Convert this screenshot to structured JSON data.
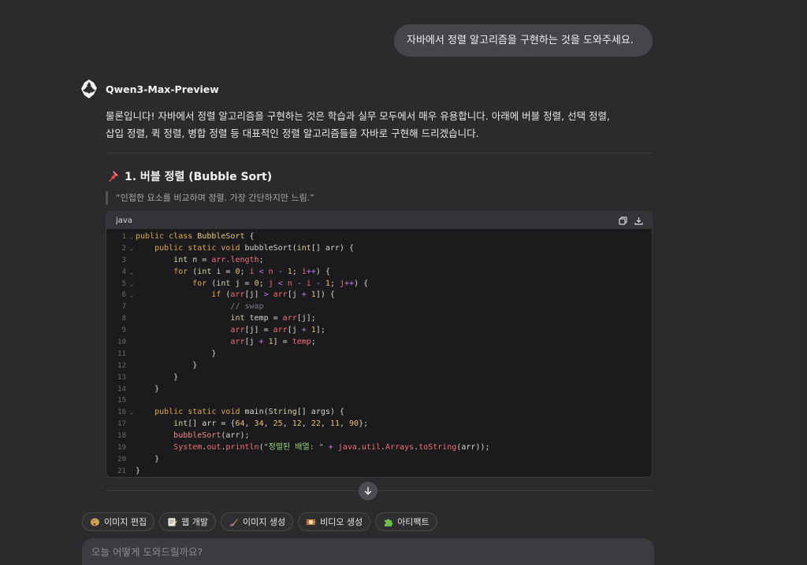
{
  "user_message": "자바에서 정렬 알고리즘을 구현하는 것을 도와주세요.",
  "assistant": {
    "model_name": "Qwen3-Max-Preview",
    "intro_line1": "물론입니다! 자바에서 정렬 알고리즘을 구현하는 것은 학습과 실무 모두에서 매우 유용합니다. 아래에 버블 정렬, 선택 정렬,",
    "intro_line2": "삽입 정렬, 퀵 정렬, 병합 정렬 등 대표적인 정렬 알고리즘들을 자바로 구현해 드리겠습니다.",
    "section_title": "1. 버블 정렬 (Bubble Sort)",
    "quote": "“인접한 요소를 비교하며 정렬. 가장 간단하지만 느림.”"
  },
  "code": {
    "language": "java",
    "copy_icon": "copy-icon",
    "download_icon": "download-icon",
    "lines": [
      {
        "n": "1",
        "fold": true,
        "tokens": [
          [
            "kw",
            "public "
          ],
          [
            "kw",
            "class "
          ],
          [
            "cls",
            "BubbleSort"
          ],
          [
            "pl",
            " {"
          ]
        ]
      },
      {
        "n": "2",
        "fold": true,
        "tokens": [
          [
            "pl",
            "    "
          ],
          [
            "kw",
            "public "
          ],
          [
            "kw",
            "static "
          ],
          [
            "kw",
            "void "
          ],
          [
            "pl",
            "bubbleSort("
          ],
          [
            "ty",
            "int"
          ],
          [
            "pl",
            "[] arr) {"
          ]
        ]
      },
      {
        "n": "3",
        "fold": false,
        "tokens": [
          [
            "pl",
            "        "
          ],
          [
            "ty",
            "int "
          ],
          [
            "pl",
            "n = "
          ],
          [
            "var",
            "arr.length"
          ],
          [
            "pl",
            ";"
          ]
        ]
      },
      {
        "n": "4",
        "fold": true,
        "tokens": [
          [
            "pl",
            "        "
          ],
          [
            "kw",
            "for "
          ],
          [
            "pl",
            "("
          ],
          [
            "ty",
            "int "
          ],
          [
            "pl",
            "i = "
          ],
          [
            "num",
            "0"
          ],
          [
            "pl",
            "; "
          ],
          [
            "var",
            "i"
          ],
          [
            "op",
            " < "
          ],
          [
            "var",
            "n"
          ],
          [
            "op",
            " - "
          ],
          [
            "num",
            "1"
          ],
          [
            "pl",
            "; "
          ],
          [
            "var",
            "i"
          ],
          [
            "op",
            "++"
          ],
          [
            "pl",
            ") {"
          ]
        ]
      },
      {
        "n": "5",
        "fold": true,
        "tokens": [
          [
            "pl",
            "            "
          ],
          [
            "kw",
            "for "
          ],
          [
            "pl",
            "("
          ],
          [
            "ty",
            "int "
          ],
          [
            "pl",
            "j = "
          ],
          [
            "num",
            "0"
          ],
          [
            "pl",
            "; "
          ],
          [
            "var",
            "j"
          ],
          [
            "op",
            " < "
          ],
          [
            "var",
            "n"
          ],
          [
            "op",
            " - "
          ],
          [
            "var",
            "i"
          ],
          [
            "op",
            " - "
          ],
          [
            "num",
            "1"
          ],
          [
            "pl",
            "; "
          ],
          [
            "var",
            "j"
          ],
          [
            "op",
            "++"
          ],
          [
            "pl",
            ") {"
          ]
        ]
      },
      {
        "n": "6",
        "fold": true,
        "tokens": [
          [
            "pl",
            "                "
          ],
          [
            "kw",
            "if "
          ],
          [
            "pl",
            "("
          ],
          [
            "var",
            "arr"
          ],
          [
            "pl",
            "[j] "
          ],
          [
            "op",
            "> "
          ],
          [
            "var",
            "arr"
          ],
          [
            "pl",
            "[j "
          ],
          [
            "op",
            "+ "
          ],
          [
            "num",
            "1"
          ],
          [
            "pl",
            "]) {"
          ]
        ]
      },
      {
        "n": "7",
        "fold": false,
        "tokens": [
          [
            "pl",
            "                    "
          ],
          [
            "cm",
            "// swap"
          ]
        ]
      },
      {
        "n": "8",
        "fold": false,
        "tokens": [
          [
            "pl",
            "                    "
          ],
          [
            "ty",
            "int "
          ],
          [
            "pl",
            "temp = "
          ],
          [
            "var",
            "arr"
          ],
          [
            "pl",
            "[j];"
          ]
        ]
      },
      {
        "n": "9",
        "fold": false,
        "tokens": [
          [
            "pl",
            "                    "
          ],
          [
            "var",
            "arr"
          ],
          [
            "pl",
            "[j] = "
          ],
          [
            "var",
            "arr"
          ],
          [
            "pl",
            "[j "
          ],
          [
            "op",
            "+ "
          ],
          [
            "num",
            "1"
          ],
          [
            "pl",
            "];"
          ]
        ]
      },
      {
        "n": "10",
        "fold": false,
        "tokens": [
          [
            "pl",
            "                    "
          ],
          [
            "var",
            "arr"
          ],
          [
            "pl",
            "[j "
          ],
          [
            "op",
            "+ "
          ],
          [
            "num",
            "1"
          ],
          [
            "pl",
            "] = "
          ],
          [
            "var",
            "temp"
          ],
          [
            "pl",
            ";"
          ]
        ]
      },
      {
        "n": "11",
        "fold": false,
        "tokens": [
          [
            "pl",
            "                }"
          ]
        ]
      },
      {
        "n": "12",
        "fold": false,
        "tokens": [
          [
            "pl",
            "            }"
          ]
        ]
      },
      {
        "n": "13",
        "fold": false,
        "tokens": [
          [
            "pl",
            "        }"
          ]
        ]
      },
      {
        "n": "14",
        "fold": false,
        "tokens": [
          [
            "pl",
            "    }"
          ]
        ]
      },
      {
        "n": "15",
        "fold": false,
        "tokens": [
          [
            "pl",
            ""
          ]
        ]
      },
      {
        "n": "16",
        "fold": true,
        "tokens": [
          [
            "pl",
            "    "
          ],
          [
            "kw",
            "public "
          ],
          [
            "kw",
            "static "
          ],
          [
            "kw",
            "void "
          ],
          [
            "pl",
            "main("
          ],
          [
            "ty",
            "String"
          ],
          [
            "pl",
            "[] args) {"
          ]
        ]
      },
      {
        "n": "17",
        "fold": false,
        "tokens": [
          [
            "pl",
            "        "
          ],
          [
            "ty",
            "int"
          ],
          [
            "pl",
            "[] arr = {"
          ],
          [
            "num",
            "64"
          ],
          [
            "pl",
            ", "
          ],
          [
            "num",
            "34"
          ],
          [
            "pl",
            ", "
          ],
          [
            "num",
            "25"
          ],
          [
            "pl",
            ", "
          ],
          [
            "num",
            "12"
          ],
          [
            "pl",
            ", "
          ],
          [
            "num",
            "22"
          ],
          [
            "pl",
            ", "
          ],
          [
            "num",
            "11"
          ],
          [
            "pl",
            ", "
          ],
          [
            "num",
            "90"
          ],
          [
            "pl",
            "};"
          ]
        ]
      },
      {
        "n": "18",
        "fold": false,
        "tokens": [
          [
            "pl",
            "        "
          ],
          [
            "fn",
            "bubbleSort"
          ],
          [
            "pl",
            "(arr);"
          ]
        ]
      },
      {
        "n": "19",
        "fold": false,
        "tokens": [
          [
            "pl",
            "        "
          ],
          [
            "var",
            "System"
          ],
          [
            "pl",
            "."
          ],
          [
            "var",
            "out"
          ],
          [
            "pl",
            "."
          ],
          [
            "var",
            "println"
          ],
          [
            "pl",
            "("
          ],
          [
            "str",
            "\"정렬된 배열: \""
          ],
          [
            "op",
            " + "
          ],
          [
            "var",
            "java"
          ],
          [
            "pl",
            "."
          ],
          [
            "var",
            "util"
          ],
          [
            "pl",
            "."
          ],
          [
            "var",
            "Arrays"
          ],
          [
            "pl",
            "."
          ],
          [
            "var",
            "toString"
          ],
          [
            "pl",
            "(arr));"
          ]
        ]
      },
      {
        "n": "20",
        "fold": false,
        "tokens": [
          [
            "pl",
            "    }"
          ]
        ]
      },
      {
        "n": "21",
        "fold": false,
        "tokens": [
          [
            "pl",
            "}"
          ]
        ]
      }
    ]
  },
  "chips": [
    {
      "label": "이미지 편집",
      "icon": "paint-palette-icon",
      "color": "#d9a24a"
    },
    {
      "label": "웹 개발",
      "icon": "memo-icon",
      "color": "#e8c774"
    },
    {
      "label": "이미지 생성",
      "icon": "brush-icon",
      "color": "#c9a35a"
    },
    {
      "label": "비디오 생성",
      "icon": "film-icon",
      "color": "#d08c3c"
    },
    {
      "label": "아티팩트",
      "icon": "puzzle-icon",
      "color": "#6cc04a"
    }
  ],
  "input": {
    "placeholder": "오늘 어떻게 도와드릴까요?"
  }
}
